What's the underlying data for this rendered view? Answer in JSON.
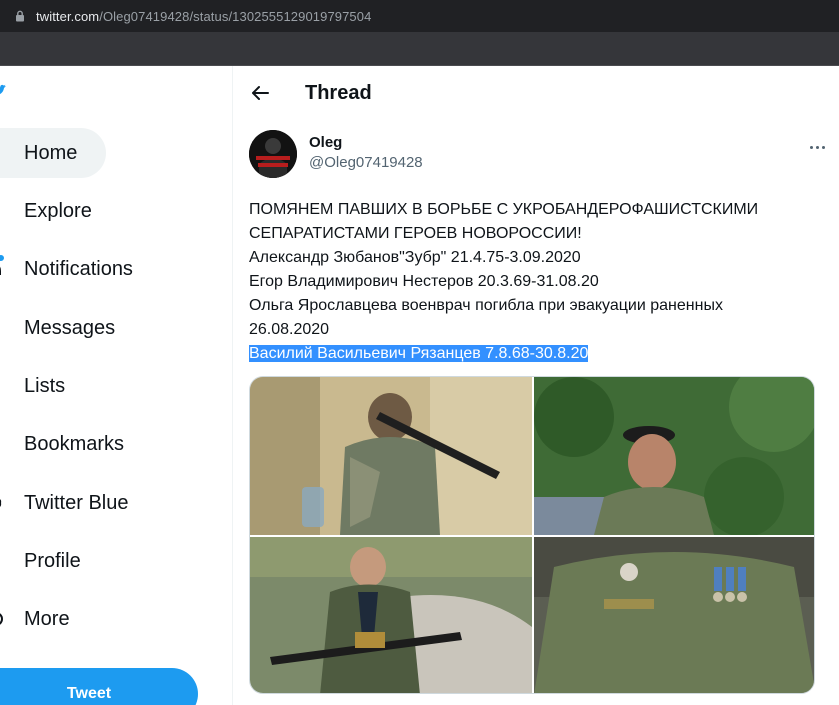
{
  "browser": {
    "url_host": "twitter.com",
    "url_path": "/Oleg07419428/status/1302555129019797504"
  },
  "sidebar": {
    "items": [
      {
        "label": "Home",
        "icon": "home-icon"
      },
      {
        "label": "Explore",
        "icon": "hashtag-icon"
      },
      {
        "label": "Notifications",
        "icon": "bell-icon"
      },
      {
        "label": "Messages",
        "icon": "envelope-icon"
      },
      {
        "label": "Lists",
        "icon": "list-icon"
      },
      {
        "label": "Bookmarks",
        "icon": "bookmark-icon"
      },
      {
        "label": "Twitter Blue",
        "icon": "twitter-blue-icon"
      },
      {
        "label": "Profile",
        "icon": "profile-icon"
      },
      {
        "label": "More",
        "icon": "more-circle-icon"
      }
    ],
    "tweet_button": "Tweet"
  },
  "header": {
    "title": "Thread"
  },
  "tweet": {
    "author_name": "Oleg",
    "author_handle": "@Oleg07419428",
    "lines": [
      "ПОМЯНЕМ ПАВШИХ В БОРЬБЕ С УКРОБАНДЕРОФАШИСТСКИМИ",
      "СЕПАРАТИСТАМИ ГЕРОЕВ НОВОРОССИИ!",
      "Александр Зюбанов\"Зубр\" 21.4.75-3.09.2020",
      "Егор Владимирович Нестеров 20.3.69-31.08.20",
      "Ольга Ярославцева военврач погибла при эвакуации раненных",
      "26.08.2020"
    ],
    "highlighted_line": "Василий Васильевич Рязанцев 7.8.68-30.8.20"
  },
  "colors": {
    "accent": "#1d9bf0",
    "selection": "#3390ff",
    "text": "#0f1419",
    "secondary": "#536471"
  }
}
